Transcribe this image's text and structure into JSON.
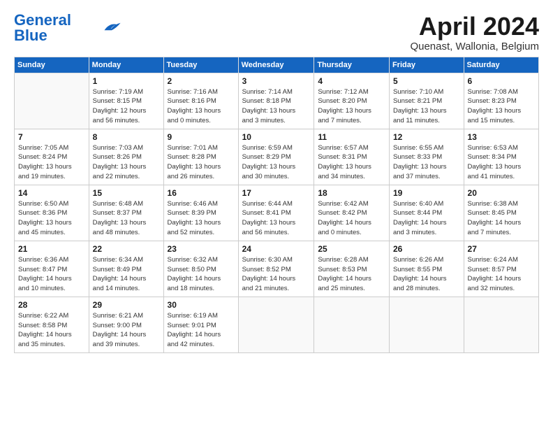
{
  "logo": {
    "line1": "General",
    "line2": "Blue"
  },
  "title": "April 2024",
  "subtitle": "Quenast, Wallonia, Belgium",
  "days_header": [
    "Sunday",
    "Monday",
    "Tuesday",
    "Wednesday",
    "Thursday",
    "Friday",
    "Saturday"
  ],
  "weeks": [
    [
      {
        "num": "",
        "info": ""
      },
      {
        "num": "1",
        "info": "Sunrise: 7:19 AM\nSunset: 8:15 PM\nDaylight: 12 hours\nand 56 minutes."
      },
      {
        "num": "2",
        "info": "Sunrise: 7:16 AM\nSunset: 8:16 PM\nDaylight: 13 hours\nand 0 minutes."
      },
      {
        "num": "3",
        "info": "Sunrise: 7:14 AM\nSunset: 8:18 PM\nDaylight: 13 hours\nand 3 minutes."
      },
      {
        "num": "4",
        "info": "Sunrise: 7:12 AM\nSunset: 8:20 PM\nDaylight: 13 hours\nand 7 minutes."
      },
      {
        "num": "5",
        "info": "Sunrise: 7:10 AM\nSunset: 8:21 PM\nDaylight: 13 hours\nand 11 minutes."
      },
      {
        "num": "6",
        "info": "Sunrise: 7:08 AM\nSunset: 8:23 PM\nDaylight: 13 hours\nand 15 minutes."
      }
    ],
    [
      {
        "num": "7",
        "info": "Sunrise: 7:05 AM\nSunset: 8:24 PM\nDaylight: 13 hours\nand 19 minutes."
      },
      {
        "num": "8",
        "info": "Sunrise: 7:03 AM\nSunset: 8:26 PM\nDaylight: 13 hours\nand 22 minutes."
      },
      {
        "num": "9",
        "info": "Sunrise: 7:01 AM\nSunset: 8:28 PM\nDaylight: 13 hours\nand 26 minutes."
      },
      {
        "num": "10",
        "info": "Sunrise: 6:59 AM\nSunset: 8:29 PM\nDaylight: 13 hours\nand 30 minutes."
      },
      {
        "num": "11",
        "info": "Sunrise: 6:57 AM\nSunset: 8:31 PM\nDaylight: 13 hours\nand 34 minutes."
      },
      {
        "num": "12",
        "info": "Sunrise: 6:55 AM\nSunset: 8:33 PM\nDaylight: 13 hours\nand 37 minutes."
      },
      {
        "num": "13",
        "info": "Sunrise: 6:53 AM\nSunset: 8:34 PM\nDaylight: 13 hours\nand 41 minutes."
      }
    ],
    [
      {
        "num": "14",
        "info": "Sunrise: 6:50 AM\nSunset: 8:36 PM\nDaylight: 13 hours\nand 45 minutes."
      },
      {
        "num": "15",
        "info": "Sunrise: 6:48 AM\nSunset: 8:37 PM\nDaylight: 13 hours\nand 48 minutes."
      },
      {
        "num": "16",
        "info": "Sunrise: 6:46 AM\nSunset: 8:39 PM\nDaylight: 13 hours\nand 52 minutes."
      },
      {
        "num": "17",
        "info": "Sunrise: 6:44 AM\nSunset: 8:41 PM\nDaylight: 13 hours\nand 56 minutes."
      },
      {
        "num": "18",
        "info": "Sunrise: 6:42 AM\nSunset: 8:42 PM\nDaylight: 14 hours\nand 0 minutes."
      },
      {
        "num": "19",
        "info": "Sunrise: 6:40 AM\nSunset: 8:44 PM\nDaylight: 14 hours\nand 3 minutes."
      },
      {
        "num": "20",
        "info": "Sunrise: 6:38 AM\nSunset: 8:45 PM\nDaylight: 14 hours\nand 7 minutes."
      }
    ],
    [
      {
        "num": "21",
        "info": "Sunrise: 6:36 AM\nSunset: 8:47 PM\nDaylight: 14 hours\nand 10 minutes."
      },
      {
        "num": "22",
        "info": "Sunrise: 6:34 AM\nSunset: 8:49 PM\nDaylight: 14 hours\nand 14 minutes."
      },
      {
        "num": "23",
        "info": "Sunrise: 6:32 AM\nSunset: 8:50 PM\nDaylight: 14 hours\nand 18 minutes."
      },
      {
        "num": "24",
        "info": "Sunrise: 6:30 AM\nSunset: 8:52 PM\nDaylight: 14 hours\nand 21 minutes."
      },
      {
        "num": "25",
        "info": "Sunrise: 6:28 AM\nSunset: 8:53 PM\nDaylight: 14 hours\nand 25 minutes."
      },
      {
        "num": "26",
        "info": "Sunrise: 6:26 AM\nSunset: 8:55 PM\nDaylight: 14 hours\nand 28 minutes."
      },
      {
        "num": "27",
        "info": "Sunrise: 6:24 AM\nSunset: 8:57 PM\nDaylight: 14 hours\nand 32 minutes."
      }
    ],
    [
      {
        "num": "28",
        "info": "Sunrise: 6:22 AM\nSunset: 8:58 PM\nDaylight: 14 hours\nand 35 minutes."
      },
      {
        "num": "29",
        "info": "Sunrise: 6:21 AM\nSunset: 9:00 PM\nDaylight: 14 hours\nand 39 minutes."
      },
      {
        "num": "30",
        "info": "Sunrise: 6:19 AM\nSunset: 9:01 PM\nDaylight: 14 hours\nand 42 minutes."
      },
      {
        "num": "",
        "info": ""
      },
      {
        "num": "",
        "info": ""
      },
      {
        "num": "",
        "info": ""
      },
      {
        "num": "",
        "info": ""
      }
    ]
  ]
}
